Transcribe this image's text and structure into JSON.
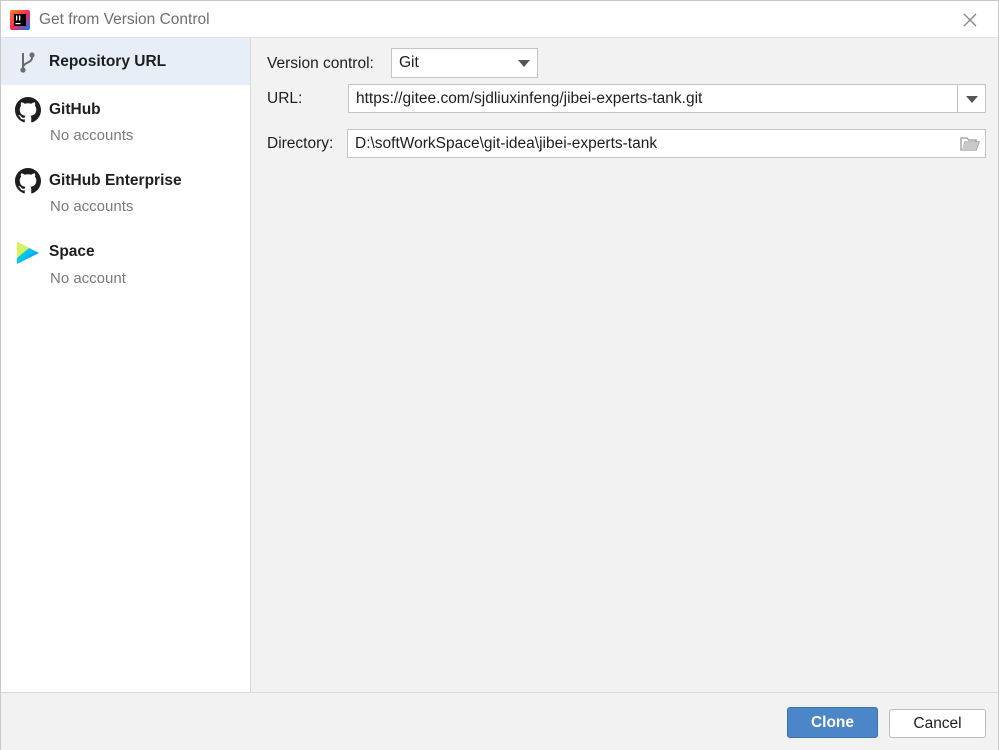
{
  "window": {
    "title": "Get from Version Control",
    "app_icon": "intellij-idea-icon",
    "close_icon": "close-icon"
  },
  "sidebar": {
    "items": [
      {
        "label": "Repository URL",
        "sub": "",
        "icon": "git-branch-icon",
        "selected": true
      },
      {
        "label": "GitHub",
        "sub": "No accounts",
        "icon": "github-icon",
        "selected": false
      },
      {
        "label": "GitHub Enterprise",
        "sub": "No accounts",
        "icon": "github-icon",
        "selected": false
      },
      {
        "label": "Space",
        "sub": "No account",
        "icon": "space-icon",
        "selected": false
      }
    ]
  },
  "form": {
    "version_control_label": "Version control:",
    "version_control_value": "Git",
    "url_label": "URL:",
    "url_value": "https://gitee.com/sjdliuxinfeng/jibei-experts-tank.git",
    "directory_label": "Directory:",
    "directory_value": "D:\\softWorkSpace\\git-idea\\jibei-experts-tank",
    "folder_icon": "folder-open-icon"
  },
  "buttons": {
    "clone_label": "Clone",
    "cancel_label": "Cancel"
  },
  "colors": {
    "accent": "#4a86c8",
    "selected_bg": "#e8eef7"
  }
}
